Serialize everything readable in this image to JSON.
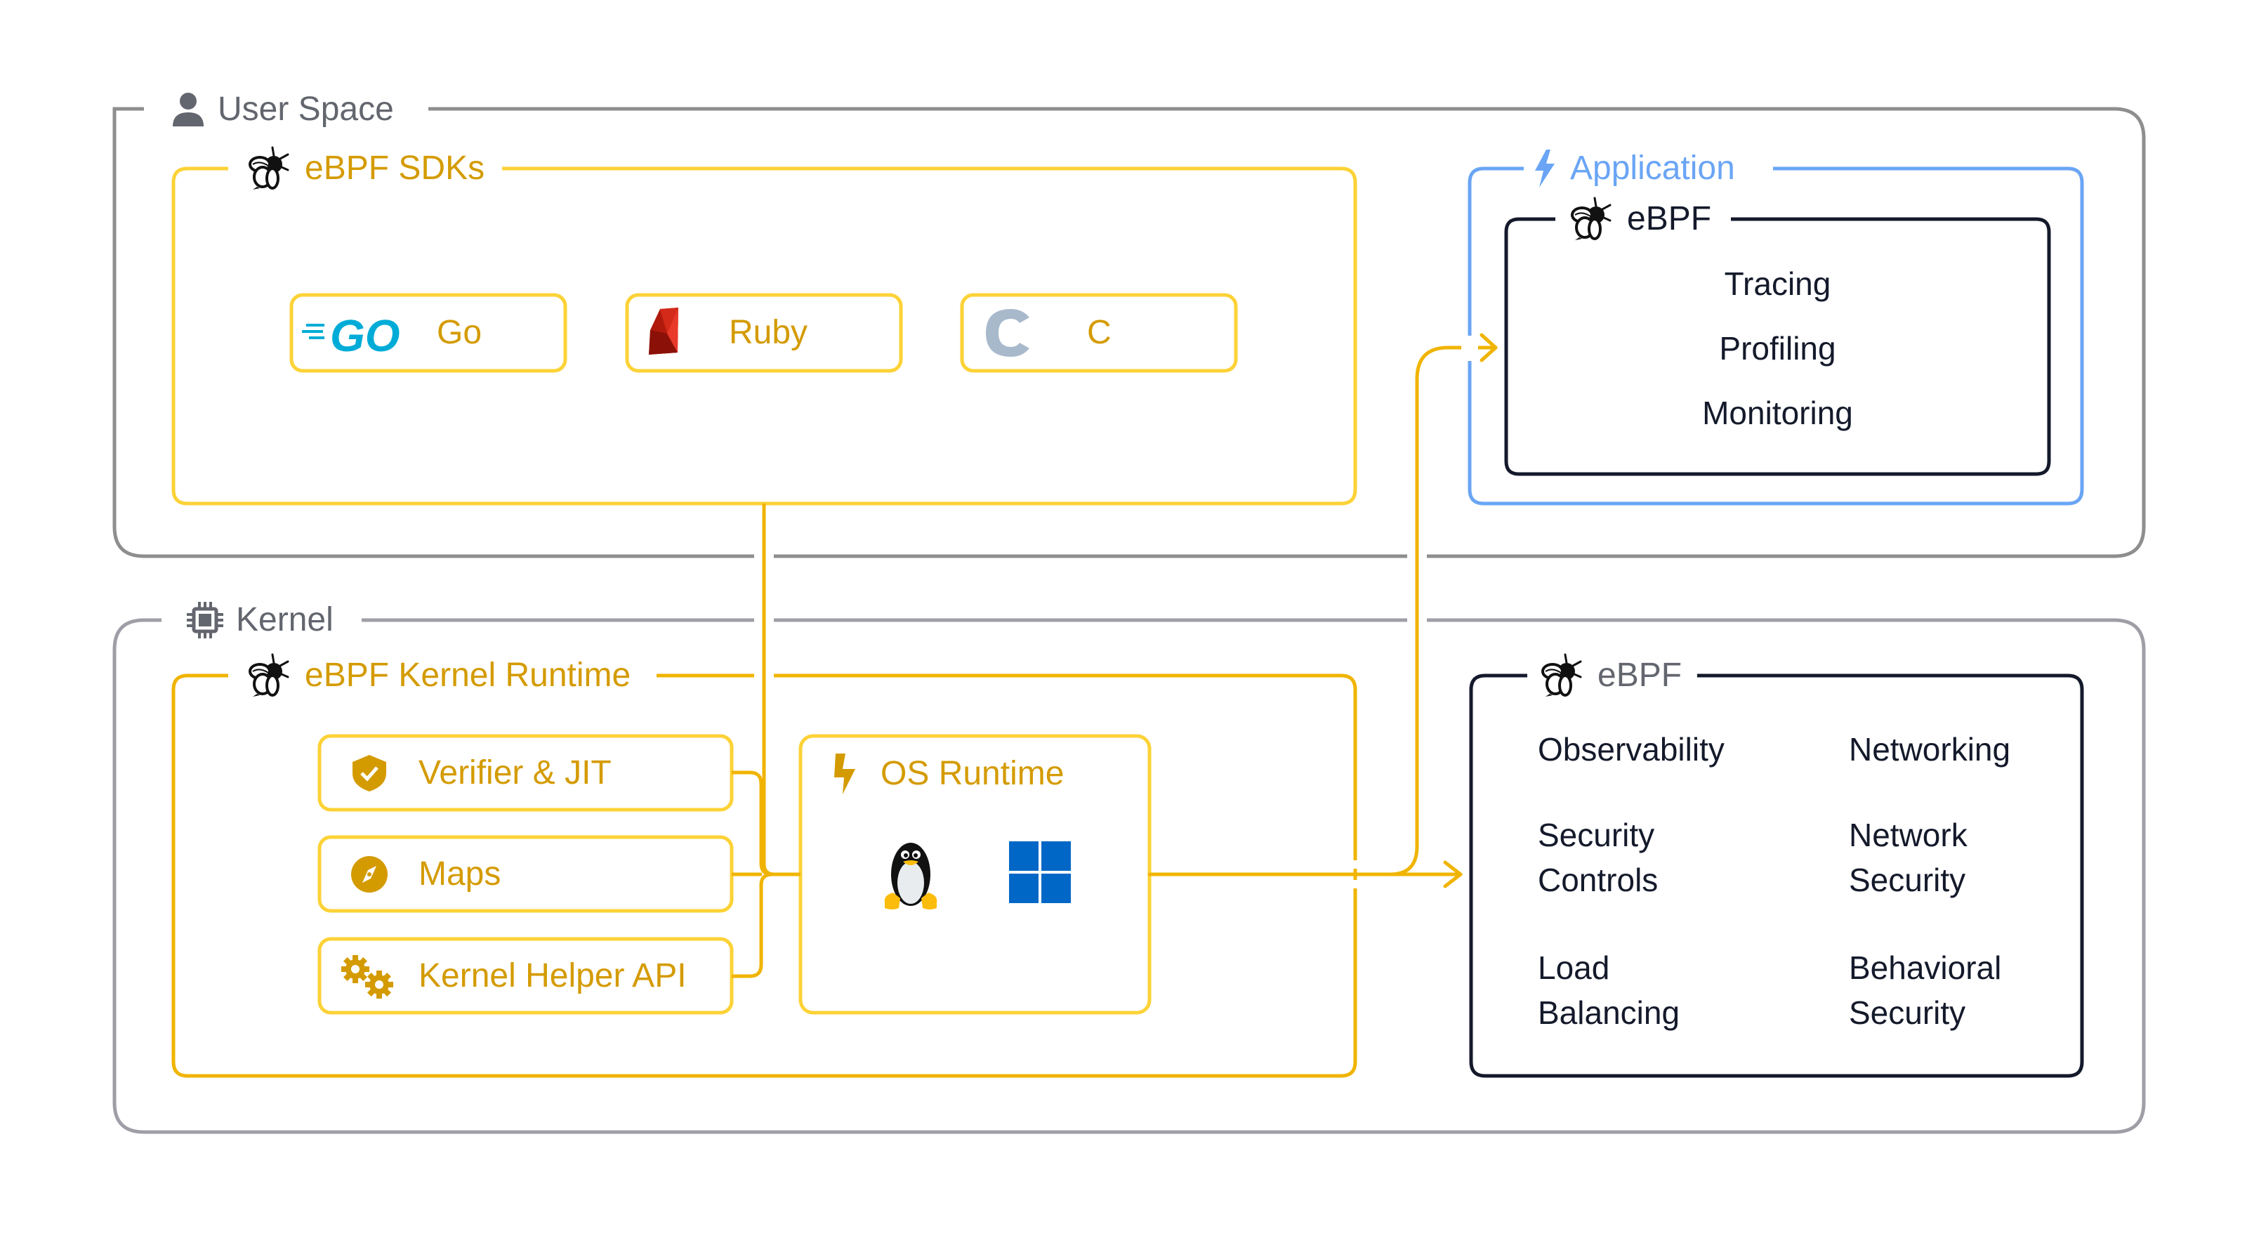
{
  "user_space": {
    "title": "User Space",
    "icon": "user-icon"
  },
  "sdks": {
    "title": "eBPF SDKs",
    "icon": "bee-icon",
    "items": [
      {
        "label": "Go",
        "icon": "go-logo-icon"
      },
      {
        "label": "Ruby",
        "icon": "ruby-logo-icon"
      },
      {
        "label": "C",
        "icon": "c-logo-icon"
      }
    ]
  },
  "application": {
    "title": "Application",
    "icon": "lightning-icon",
    "ebpf": {
      "title": "eBPF",
      "icon": "bee-icon",
      "items": [
        "Tracing",
        "Profiling",
        "Monitoring"
      ]
    }
  },
  "kernel": {
    "title": "Kernel",
    "icon": "chip-icon"
  },
  "kernel_runtime": {
    "title": "eBPF Kernel Runtime",
    "icon": "bee-icon",
    "components": [
      {
        "label": "Verifier & JIT",
        "icon": "shield-check-icon"
      },
      {
        "label": "Maps",
        "icon": "compass-icon"
      },
      {
        "label": "Kernel Helper API",
        "icon": "gears-icon"
      }
    ],
    "os_runtime": {
      "title": "OS Runtime",
      "icon": "lightning-icon",
      "platforms": [
        "linux-tux-icon",
        "windows-logo-icon"
      ]
    }
  },
  "kernel_ebpf": {
    "title": "eBPF",
    "icon": "bee-icon",
    "use_cases": [
      "Observability",
      "Networking",
      "Security\nControls",
      "Network\nSecurity",
      "Load\nBalancing",
      "Behavioral\nSecurity"
    ]
  },
  "colors": {
    "frame_gray": "#8e8e8e",
    "gold_frame": "#fcd236",
    "gold_line": "#f0b400",
    "gold_text": "#d49b00",
    "blue": "#6aa5f5",
    "dark": "#141a2b",
    "go_blue": "#00acd7",
    "windows_blue": "#0067c6",
    "c_gray": "#a9b9cc"
  }
}
